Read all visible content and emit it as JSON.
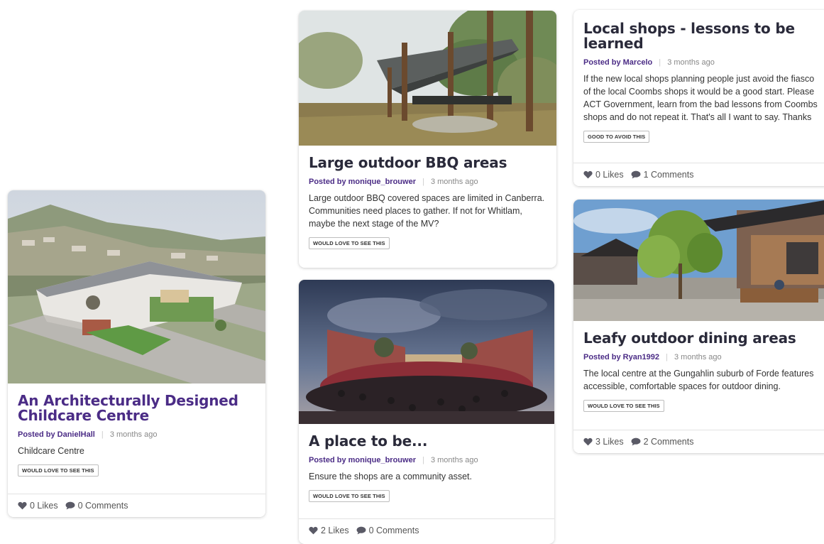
{
  "cards": [
    {
      "title": "An Architecturally Designed Childcare Centre",
      "posted_prefix": "Posted by",
      "author": "DanielHall",
      "time": "3 months ago",
      "description": "Childcare Centre",
      "tag": "WOULD LOVE TO SEE THIS",
      "likes": "0 Likes",
      "comments": "0 Comments"
    },
    {
      "title": "Large outdoor BBQ areas",
      "posted_prefix": "Posted by",
      "author": "monique_brouwer",
      "time": "3 months ago",
      "description": "Large outdoor BBQ covered spaces are limited in Canberra. Communities need places to gather. If not for Whitlam, maybe the next stage of the MV?",
      "tag": "WOULD LOVE TO SEE THIS"
    },
    {
      "title": "A place to be...",
      "posted_prefix": "Posted by",
      "author": "monique_brouwer",
      "time": "3 months ago",
      "description": "Ensure the shops are a community asset.",
      "tag": "WOULD LOVE TO SEE THIS",
      "likes": "2 Likes",
      "comments": "0 Comments"
    },
    {
      "title": "Local shops - lessons to be learned",
      "posted_prefix": "Posted by",
      "author": "Marcelo",
      "time": "3 months ago",
      "description": "If the new local shops planning people just avoid the fiasco of the local Coombs shops it would be a good start. Please ACT Government, learn from the bad lessons from Coombs shops and do not repeat it. That's all I want to say. Thanks",
      "tag": "GOOD TO AVOID THIS",
      "likes": "0 Likes",
      "comments": "1 Comments"
    },
    {
      "title": "Leafy outdoor dining areas",
      "posted_prefix": "Posted by",
      "author": "Ryan1992",
      "time": "3 months ago",
      "description": "The local centre at the Gungahlin suburb of Forde features accessible, comfortable spaces for outdoor dining.",
      "tag": "WOULD LOVE TO SEE THIS",
      "likes": "3 Likes",
      "comments": "2 Comments"
    }
  ],
  "icons": {
    "like": "heart-icon",
    "comment": "comment-bubble-icon"
  },
  "colors": {
    "accent": "#4b2c86",
    "icon": "#5a5a66"
  }
}
